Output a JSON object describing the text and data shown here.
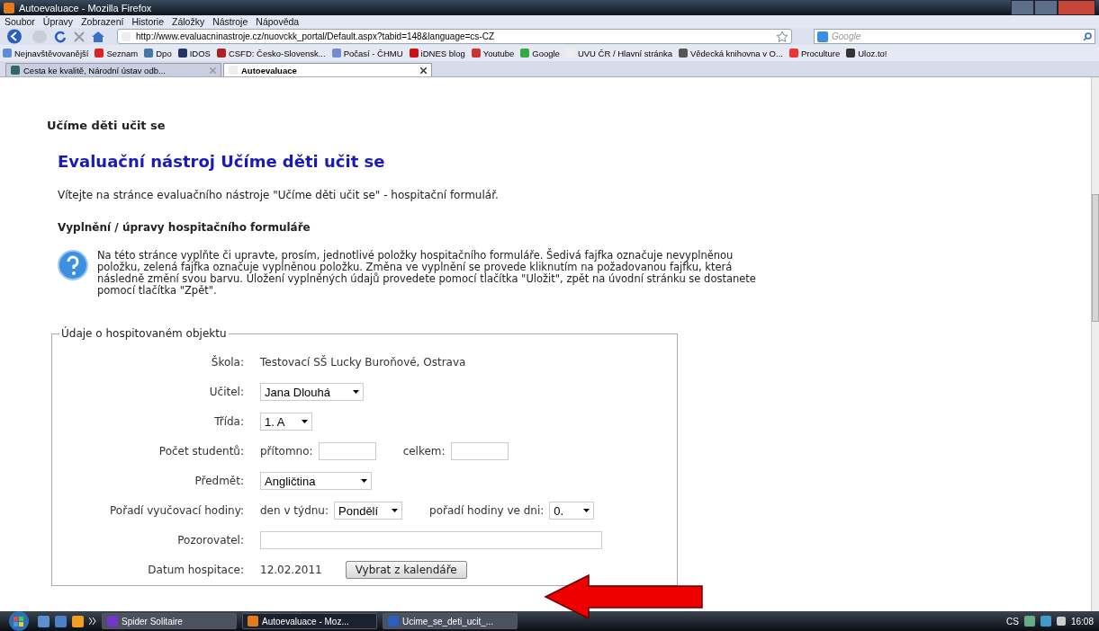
{
  "window": {
    "title": "Autoevaluace - Mozilla Firefox"
  },
  "menu": [
    "Soubor",
    "Úpravy",
    "Zobrazení",
    "Historie",
    "Záložky",
    "Nástroje",
    "Nápověda"
  ],
  "address": {
    "value": "http://www.evaluacninastroje.cz/nuovckk_portal/Default.aspx?tabid=148&language=cs-CZ"
  },
  "search": {
    "placeholder": "Google"
  },
  "bookmarks": [
    "Nejnavštěvovanější",
    "Seznam",
    "Dpo",
    "IDOS",
    "CSFD: Česko-Slovensk...",
    "Počasí - ČHMU",
    "iDNES blog",
    "Youtube",
    "Google",
    "UVU ČR / Hlavní stránka",
    "Vědecká knihovna v O...",
    "Proculture",
    "Uloz.to!"
  ],
  "tabs": [
    {
      "label": "Cesta ke kvalitě, Národní ústav odb...",
      "selected": false
    },
    {
      "label": "Autoevaluace",
      "selected": true
    }
  ],
  "page": {
    "site_title": "Učíme děti učit se",
    "heading": "Evaluační nástroj Učíme děti učit se",
    "welcome": "Vítejte na stránce evaluačního nástroje \"Učíme děti učit se\" - hospitační formulář.",
    "subheading": "Vyplnění / úpravy hospitačního formuláře",
    "info": "Na této stránce vyplňte či upravte, prosím, jednotlivé položky hospitačního formuláře. Šedivá fajfka označuje nevyplněnou položku, zelená fajfka označuje vyplněnou položku. Změna ve vyplnění se provede kliknutím na požadovanou fajfku, která následně změní svou barvu. Uložení vyplněných údajů provedete pomocí tlačítka \"Uložit\", zpět na úvodní stránku se dostanete pomocí tlačítka \"Zpět\"."
  },
  "form": {
    "legend": "Údaje o hospitovaném objektu",
    "rows": [
      {
        "kind": "text",
        "label": "Škola:",
        "value": "Testovací SŠ Lucky Buroňové, Ostrava"
      },
      {
        "kind": "select",
        "label": "Učitel:",
        "value": "Jana Dlouhá"
      },
      {
        "kind": "select",
        "label": "Třída:",
        "value": "1. A"
      },
      {
        "kind": "pair",
        "label": "Počet studentů:",
        "first_label": "přítomno:",
        "second_label": "celkem:"
      },
      {
        "kind": "select",
        "label": "Předmět:",
        "value": "Angličtina"
      },
      {
        "kind": "order",
        "label": "Pořadí vyučovací hodiny:",
        "first_label": "den v týdnu:",
        "first_value": "Pondělí",
        "second_label": "pořadí hodiny ve dni:",
        "second_value": "0."
      },
      {
        "kind": "input",
        "label": "Pozorovatel:"
      },
      {
        "kind": "date",
        "label": "Datum hospitace:",
        "value": "12.02.2011",
        "button": "Vybrat z kalendáře"
      }
    ]
  },
  "taskbar": {
    "tasks": [
      {
        "label": "Spider Solitaire",
        "selected": false
      },
      {
        "label": "Autoevaluace - Moz...",
        "selected": true
      },
      {
        "label": "Ucime_se_deti_ucit_...",
        "selected": false
      }
    ],
    "language": "CS",
    "clock": "16:08"
  }
}
